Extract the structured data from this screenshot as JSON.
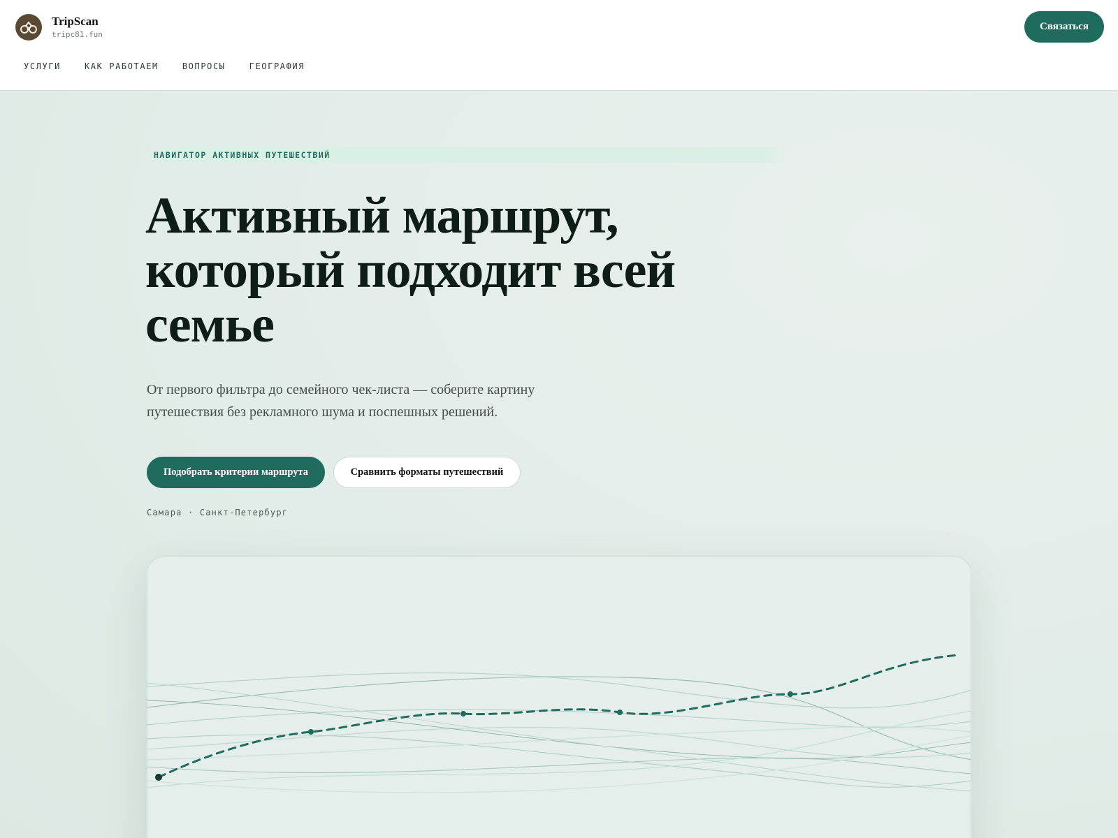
{
  "header": {
    "brand_name": "TripScan",
    "brand_domain": "tripc81.fun",
    "contact_label": "Связаться",
    "nav": [
      "УСЛУГИ",
      "КАК РАБОТАЕМ",
      "ВОПРОСЫ",
      "ГЕОГРАФИЯ"
    ]
  },
  "hero": {
    "eyebrow": "НАВИГАТОР АКТИВНЫХ ПУТЕШЕСТВИЙ",
    "headline_line1": "Активный маршрут,",
    "headline_line2": "который подходит всей",
    "headline_line3": "семье",
    "lead_line1": "От первого фильтра до семейного чек-листа — соберите картину",
    "lead_line2": "путешествия без рекламного шума и поспешных решений.",
    "primary_cta": "Подобрать критерии маршрута",
    "secondary_cta": "Сравнить форматы путешествий",
    "cities": "Самара · Санкт-Петербург"
  },
  "icons": {
    "logo": "binoculars-icon"
  },
  "colors": {
    "accent": "#1f6b5e",
    "background": "#e2ece8",
    "text": "#0e1d18",
    "muted": "#44504b"
  }
}
